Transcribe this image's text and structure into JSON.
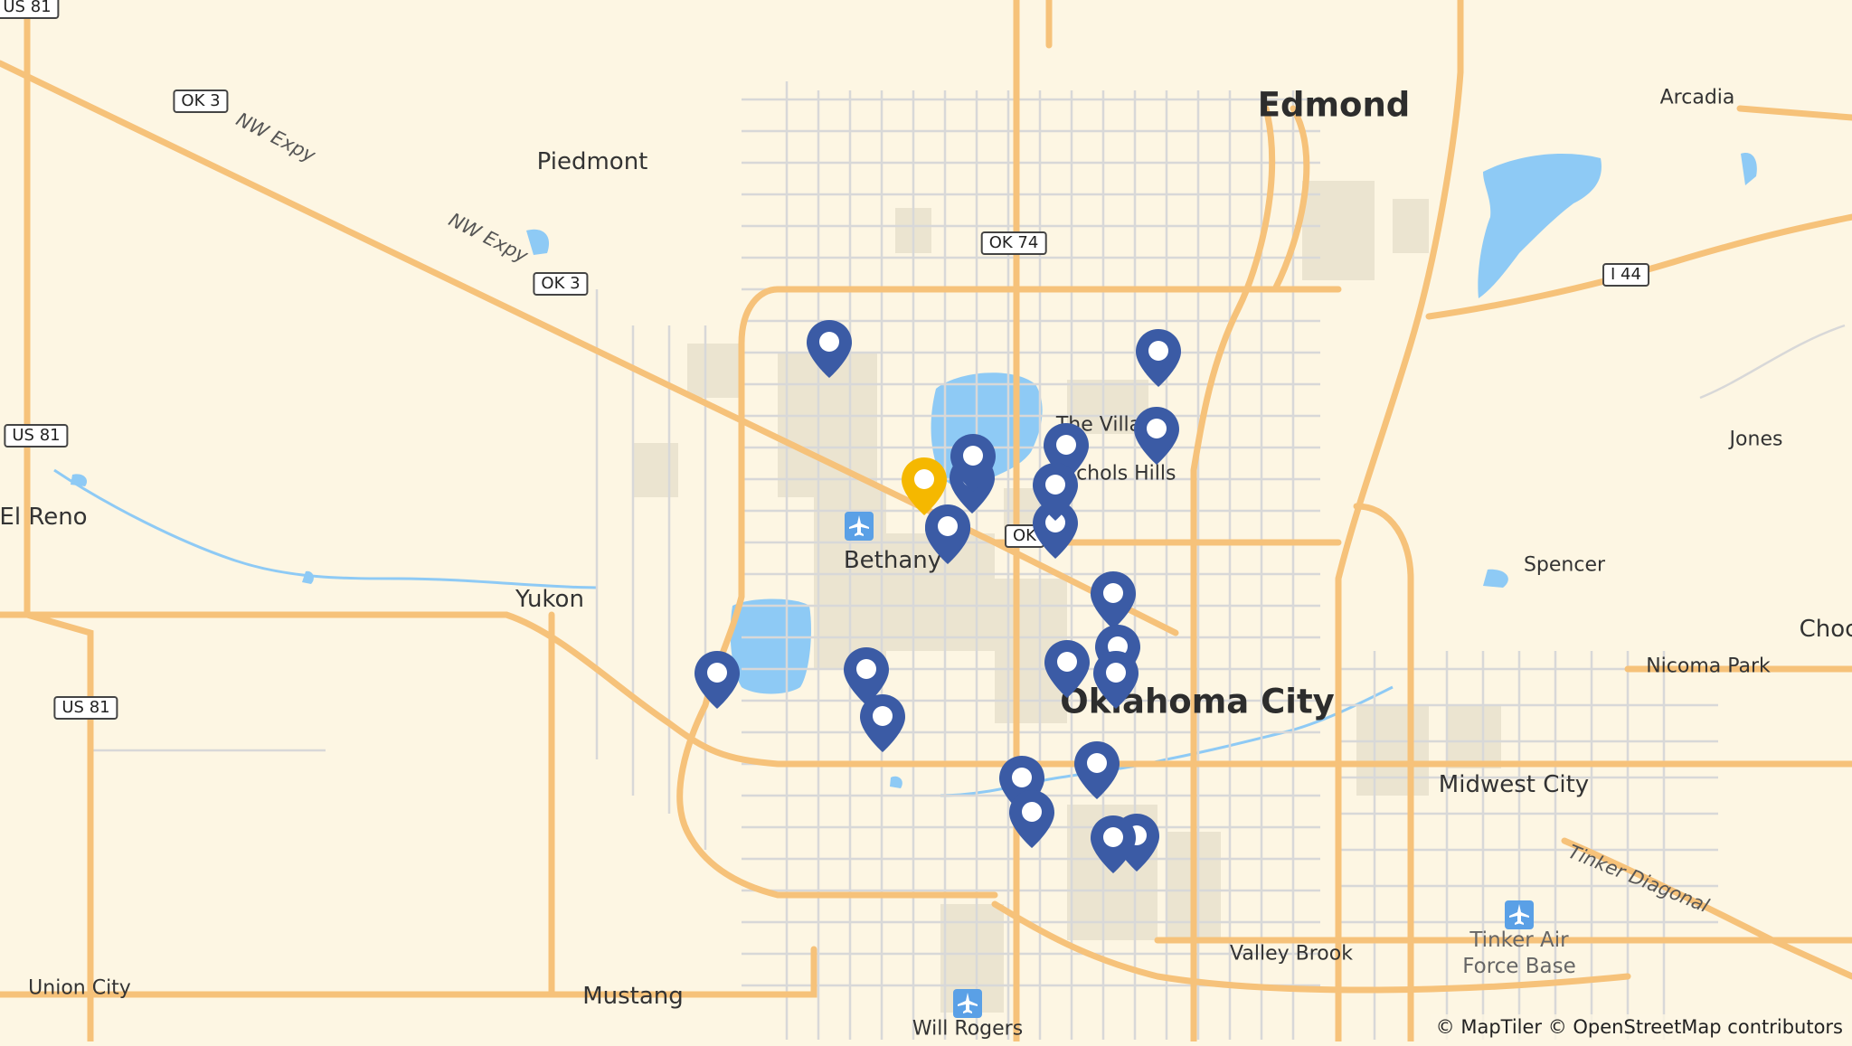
{
  "map": {
    "colors": {
      "land": "#fdf6e3",
      "water": "#8ecaf5",
      "major_road": "#f6c27a",
      "minor_road": "#d9d9d9",
      "urban": "#e8e2cf",
      "pin_blue": "#3b5ba5",
      "pin_selected": "#f5b800"
    },
    "places": {
      "edmond": "Edmond",
      "oklahoma_city": "Oklahoma City",
      "piedmont": "Piedmont",
      "arcadia": "Arcadia",
      "jones": "Jones",
      "el_reno": "El Reno",
      "yukon": "Yukon",
      "bethany": "Bethany",
      "the_village": "The Villa",
      "nichols_hills": "Nichols Hills",
      "spencer": "Spencer",
      "nicoma_park": "Nicoma Park",
      "choctaw": "Choc",
      "midwest_city": "Midwest City",
      "valley_brook": "Valley Brook",
      "union_city": "Union City",
      "mustang": "Mustang",
      "will_rogers": "Will Rogers",
      "tinker_line1": "Tinker Air",
      "tinker_line2": "Force Base"
    },
    "road_names": {
      "nw_expy_1": "NW Expy",
      "nw_expy_2": "NW Expy",
      "tinker_diagonal": "Tinker Diagonal"
    },
    "shields": {
      "us81_top": "US 81",
      "ok3_a": "OK 3",
      "ok3_b": "OK 3",
      "ok74": "OK 74",
      "i44": "I 44",
      "us81_mid": "US 81",
      "us81_low": "US 81",
      "ok_partial": "OK"
    },
    "markers": {
      "count_blue": 22,
      "count_selected": 1
    },
    "attribution": "© MapTiler © OpenStreetMap contributors"
  }
}
